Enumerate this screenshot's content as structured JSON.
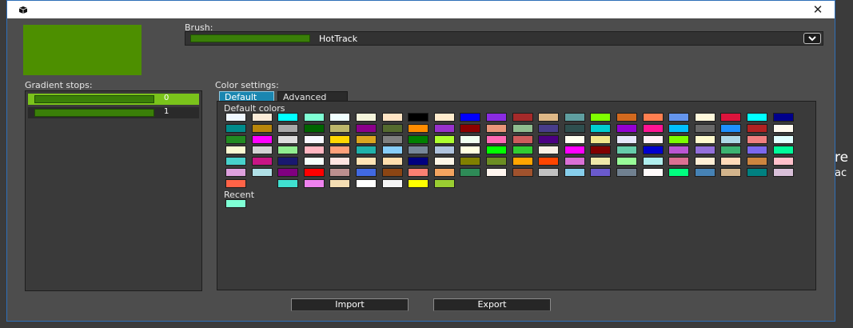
{
  "window": {
    "close_glyph": "✕",
    "icon": "app-box-icon"
  },
  "preview": {
    "color": "#4d8f00"
  },
  "brush": {
    "label": "Brush:",
    "value": "HotTrack",
    "swatch_color": "#3a7f08",
    "dropdown_icon": "chevron-down-icon"
  },
  "gradient_stops": {
    "label": "Gradient stops:",
    "stops": [
      {
        "index": "0",
        "color": "#3a7f08",
        "selected": true
      },
      {
        "index": "1",
        "color": "#3a7f08",
        "selected": false
      }
    ]
  },
  "color_settings": {
    "label": "Color settings:",
    "tabs": [
      {
        "label": "Default",
        "active": true
      },
      {
        "label": "Advanced",
        "active": false
      }
    ],
    "default_colors_label": "Default colors",
    "recent_label": "Recent",
    "default_colors": [
      [
        "#f0f8ff",
        "#faebd7",
        "#00ffff",
        "#7fffd4",
        "#f0ffff",
        "#f5f5dc",
        "#ffe4c4",
        "#000000",
        "#ffebcd",
        "#0000ff",
        "#8a2be2",
        "#a52a2a",
        "#deb887",
        "#5f9ea0",
        "#7fff00",
        "#d2691e",
        "#ff7f50",
        "#6495ed",
        "#fff8dc",
        "#dc143c",
        "#00ffff",
        "#00008b"
      ],
      [
        "#008b8b",
        "#b8860b",
        "#a9a9a9",
        "#006400",
        "#bdb76b",
        "#8b008b",
        "#556b2f",
        "#ff8c00",
        "#9932cc",
        "#8b0000",
        "#e9967a",
        "#8fbc8f",
        "#483d8b",
        "#2f4f4f",
        "#00ced1",
        "#9400d3",
        "#ff1493",
        "#00bfff",
        "#696969",
        "#1e90ff",
        "#b22222",
        "#fffaf0"
      ],
      [
        "#228b22",
        "#ff00ff",
        "#dcdcdc",
        "#f8f8ff",
        "#ffd700",
        "#daa520",
        "#808080",
        "#008000",
        "#adff2f",
        "#f0fff0",
        "#ff69b4",
        "#cd5c5c",
        "#4b0082",
        "#fffff0",
        "#f0e68c",
        "#e6e6fa",
        "#fff0f5",
        "#7cfc00",
        "#fffacd",
        "#add8e6",
        "#f08080",
        "#e0ffff"
      ],
      [
        "#fafad2",
        "#d3d3d3",
        "#90ee90",
        "#ffb6c1",
        "#ffa07a",
        "#20b2aa",
        "#87cefa",
        "#778899",
        "#b0c4de",
        "#ffffe0",
        "#00ff00",
        "#32cd32",
        "#faf0e6",
        "#ff00ff",
        "#800000",
        "#66cdaa",
        "#0000cd",
        "#ba55d3",
        "#9370db",
        "#3cb371",
        "#7b68ee",
        "#00fa9a"
      ],
      [
        "#48d1cc",
        "#c71585",
        "#191970",
        "#f5fffa",
        "#ffe4e1",
        "#ffe4b5",
        "#ffdead",
        "#000080",
        "#fdf5e6",
        "#808000",
        "#6b8e23",
        "#ffa500",
        "#ff4500",
        "#da70d6",
        "#eee8aa",
        "#98fb98",
        "#afeeee",
        "#db7093",
        "#ffefd5",
        "#ffdab9",
        "#cd853f",
        "#ffc0cb"
      ],
      [
        "#dda0dd",
        "#b0e0e6",
        "#800080",
        "#ff0000",
        "#bc8f8f",
        "#4169e1",
        "#8b4513",
        "#fa8072",
        "#f4a460",
        "#2e8b57",
        "#fff5ee",
        "#a0522d",
        "#c0c0c0",
        "#87ceeb",
        "#6a5acd",
        "#708090",
        "#fffafa",
        "#00ff7f",
        "#4682b4",
        "#d2b48c",
        "#008080",
        "#d8bfd8"
      ],
      [
        "#ff6347",
        null,
        "#40e0d0",
        "#ee82ee",
        "#f5deb3",
        "#ffffff",
        "#f5f5f5",
        "#ffff00",
        "#9acd32"
      ]
    ],
    "recent_colors": [
      "#7fffd4"
    ]
  },
  "buttons": {
    "import": "Import",
    "export": "Export"
  },
  "background_peek": {
    "line1": "re",
    "line2": "ac"
  }
}
